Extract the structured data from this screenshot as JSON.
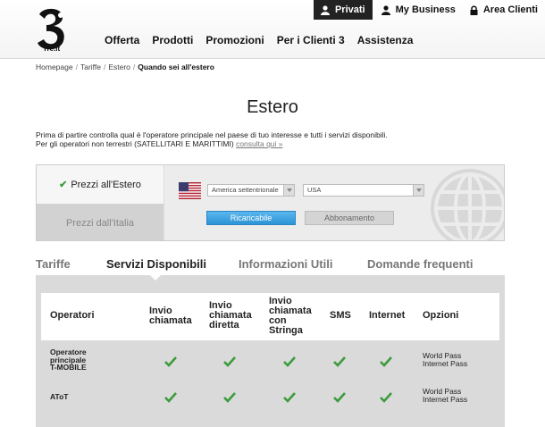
{
  "header": {
    "logo_text": "Tre.it",
    "top_nav": [
      {
        "label": "Privati",
        "icon": "person-icon",
        "active": true
      },
      {
        "label": "My Business",
        "icon": "business-person-icon",
        "active": false
      },
      {
        "label": "Area Clienti",
        "icon": "lock-icon",
        "active": false
      }
    ],
    "main_nav": [
      "Offerta",
      "Prodotti",
      "Promozioni",
      "Per i Clienti 3",
      "Assistenza"
    ]
  },
  "breadcrumb": [
    "Homepage",
    "Tariffe",
    "Estero",
    "Quando sei all'estero"
  ],
  "page": {
    "title": "Estero",
    "intro_line1": "Prima di partire controlla qual è l'operatore principale nel paese di tuo interesse e tutti i servizi disponibili.",
    "intro_line2": "Per gli operatori non terrestri (SATELLITARI E MARITTIMI)",
    "intro_link": "consulta qui »"
  },
  "ratebox": {
    "tab_active": "Prezzi all'Estero",
    "tab_inactive": "Prezzi dall'Italia",
    "region_select": "America settentrionale",
    "country_select": "USA",
    "btn_ricaricabile": "Ricaricabile",
    "btn_abbonamento": "Abbonamento",
    "colors": {
      "accent_blue": "#2c94d6",
      "check_green": "#3b9c3b"
    }
  },
  "tabs": [
    "Tariffe",
    "Servizi Disponibili",
    "Informazioni Utili",
    "Domande frequenti"
  ],
  "selected_tab": "Servizi Disponibili",
  "table": {
    "headers": {
      "operatori": "Operatori",
      "invio_chiamata_1": "Invio",
      "invio_chiamata_2": "chiamata",
      "diretta_1": "Invio",
      "diretta_2": "chiamata",
      "diretta_3": "diretta",
      "stringa_1": "Invio",
      "stringa_2": "chiamata",
      "stringa_3": "con",
      "stringa_4": "Stringa",
      "sms": "SMS",
      "internet": "Internet",
      "opzioni": "Opzioni"
    },
    "rows": [
      {
        "name_1": "Operatore",
        "name_2": "principale",
        "name_3": "T-MOBILE",
        "opt_1": "World Pass",
        "opt_2": "Internet Pass"
      },
      {
        "name_1": "AToT",
        "opt_1": "World Pass",
        "opt_2": "Internet Pass"
      }
    ]
  }
}
